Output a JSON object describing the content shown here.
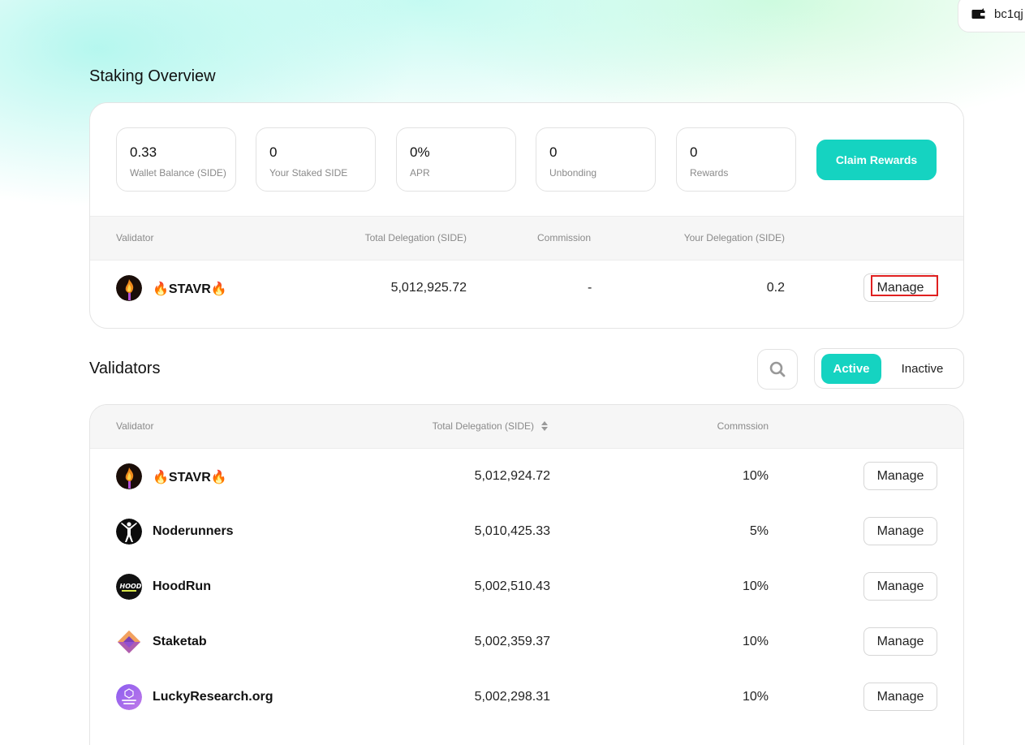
{
  "wallet": {
    "address": "bc1qj"
  },
  "overview": {
    "title": "Staking Overview",
    "stats": [
      {
        "value": "0.33",
        "label": "Wallet Balance (SIDE)"
      },
      {
        "value": "0",
        "label": "Your Staked SIDE"
      },
      {
        "value": "0%",
        "label": "APR"
      },
      {
        "value": "0",
        "label": "Unbonding"
      },
      {
        "value": "0",
        "label": "Rewards"
      }
    ],
    "claim_label": "Claim Rewards",
    "table": {
      "headers": [
        "Validator",
        "Total Delegation (SIDE)",
        "Commission",
        "Your Delegation (SIDE)"
      ],
      "row": {
        "name": "🔥STAVR🔥",
        "total": "5,012,925.72",
        "commission": "-",
        "yours": "0.2",
        "action": "Manage"
      }
    }
  },
  "validators": {
    "title": "Validators",
    "tabs": {
      "active": "Active",
      "inactive": "Inactive"
    },
    "headers": [
      "Validator",
      "Total Delegation (SIDE)",
      "Commssion"
    ],
    "rows": [
      {
        "name": "🔥STAVR🔥",
        "total": "5,012,924.72",
        "commission": "10%",
        "action": "Manage",
        "icon": "stavr-fire-avatar"
      },
      {
        "name": "Noderunners",
        "total": "5,010,425.33",
        "commission": "5%",
        "action": "Manage",
        "icon": "noderunners-avatar"
      },
      {
        "name": "HoodRun",
        "total": "5,002,510.43",
        "commission": "10%",
        "action": "Manage",
        "icon": "hoodrun-avatar"
      },
      {
        "name": "Staketab",
        "total": "5,002,359.37",
        "commission": "10%",
        "action": "Manage",
        "icon": "staketab-avatar"
      },
      {
        "name": "LuckyResearch.org",
        "total": "5,002,298.31",
        "commission": "10%",
        "action": "Manage",
        "icon": "luckyresearch-avatar"
      }
    ]
  },
  "colors": {
    "accent": "#15d3c1",
    "highlight": "#e02020"
  }
}
